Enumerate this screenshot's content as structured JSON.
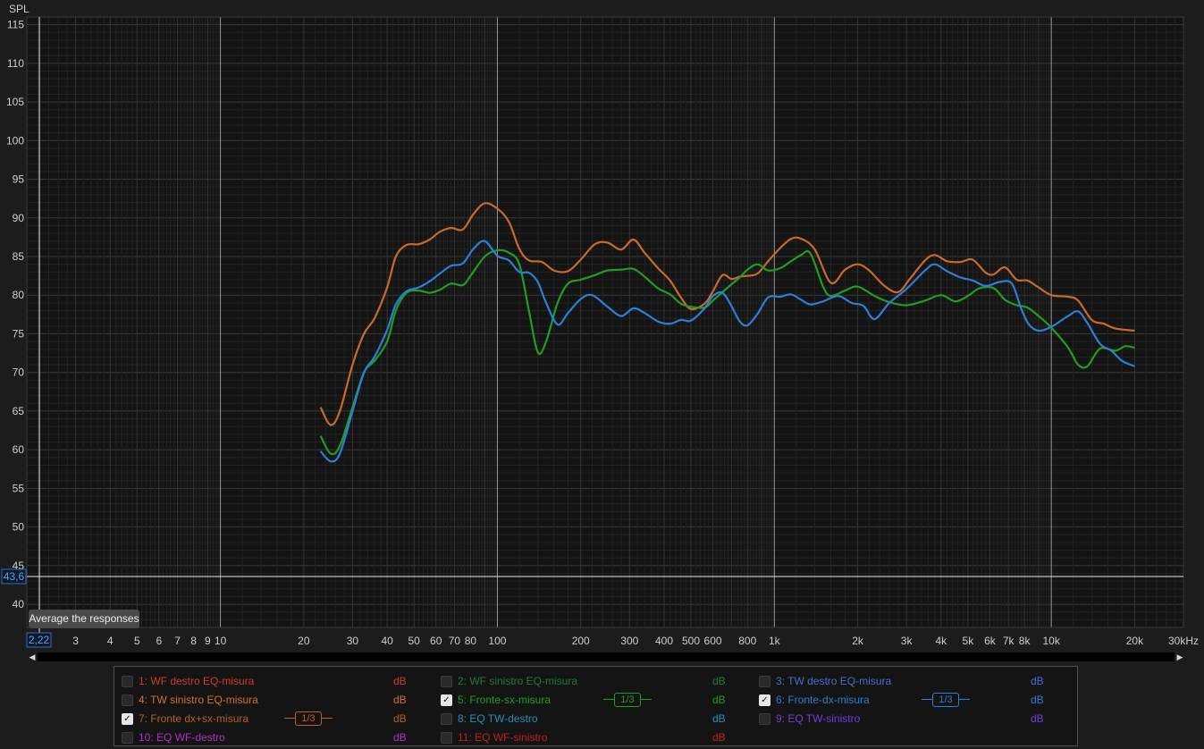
{
  "chart_data": {
    "type": "line",
    "ylabel": "SPL",
    "xunit": "kHz",
    "xscale": "log",
    "xlim": [
      2,
      30000
    ],
    "ylim": [
      37,
      116
    ],
    "grid": true,
    "y_ticks": [
      115,
      110,
      105,
      100,
      95,
      90,
      85,
      80,
      75,
      70,
      65,
      60,
      55,
      50,
      45,
      40
    ],
    "x_ticks": [
      {
        "v": 3,
        "label": "3"
      },
      {
        "v": 4,
        "label": "4"
      },
      {
        "v": 5,
        "label": "5"
      },
      {
        "v": 6,
        "label": "6"
      },
      {
        "v": 7,
        "label": "7"
      },
      {
        "v": 8,
        "label": "8"
      },
      {
        "v": 9,
        "label": "9"
      },
      {
        "v": 10,
        "label": "10"
      },
      {
        "v": 20,
        "label": "20"
      },
      {
        "v": 30,
        "label": "30"
      },
      {
        "v": 40,
        "label": "40"
      },
      {
        "v": 50,
        "label": "50"
      },
      {
        "v": 60,
        "label": "60"
      },
      {
        "v": 70,
        "label": "70"
      },
      {
        "v": 80,
        "label": "80"
      },
      {
        "v": 100,
        "label": "100"
      },
      {
        "v": 200,
        "label": "200"
      },
      {
        "v": 300,
        "label": "300"
      },
      {
        "v": 400,
        "label": "400"
      },
      {
        "v": 500,
        "label": "500"
      },
      {
        "v": 600,
        "label": "600"
      },
      {
        "v": 800,
        "label": "800"
      },
      {
        "v": 1000,
        "label": "1k"
      },
      {
        "v": 2000,
        "label": "2k"
      },
      {
        "v": 3000,
        "label": "3k"
      },
      {
        "v": 4000,
        "label": "4k"
      },
      {
        "v": 5000,
        "label": "5k"
      },
      {
        "v": 6000,
        "label": "6k"
      },
      {
        "v": 7000,
        "label": "7k"
      },
      {
        "v": 8000,
        "label": "8k"
      },
      {
        "v": 10000,
        "label": "10k"
      },
      {
        "v": 20000,
        "label": "20k"
      },
      {
        "v": 30000,
        "label": "30kHz"
      }
    ],
    "cursor": {
      "x_label": "2,22",
      "y_label": "43,6",
      "x_value": 2.22,
      "y_value": 43.6
    },
    "series": [
      {
        "name": "7: Fronte dx+sx-misura",
        "color": "#c96a28",
        "points": [
          [
            23,
            65.5
          ],
          [
            25,
            63.2
          ],
          [
            27,
            65
          ],
          [
            30,
            71
          ],
          [
            33,
            75
          ],
          [
            36,
            77
          ],
          [
            40,
            81
          ],
          [
            43,
            85
          ],
          [
            47,
            86.5
          ],
          [
            52,
            86.6
          ],
          [
            57,
            87.2
          ],
          [
            62,
            88.2
          ],
          [
            68,
            88.7
          ],
          [
            75,
            88.5
          ],
          [
            82,
            90.5
          ],
          [
            90,
            91.9
          ],
          [
            100,
            91.2
          ],
          [
            110,
            89.5
          ],
          [
            120,
            86
          ],
          [
            130,
            84.5
          ],
          [
            145,
            84.3
          ],
          [
            160,
            83.2
          ],
          [
            180,
            83.1
          ],
          [
            200,
            84.6
          ],
          [
            225,
            86.6
          ],
          [
            250,
            86.8
          ],
          [
            280,
            85.9
          ],
          [
            310,
            87.2
          ],
          [
            340,
            85.5
          ],
          [
            380,
            83.5
          ],
          [
            420,
            81.9
          ],
          [
            460,
            79.7
          ],
          [
            500,
            78.2
          ],
          [
            560,
            78.9
          ],
          [
            600,
            80.5
          ],
          [
            650,
            82.6
          ],
          [
            700,
            82.1
          ],
          [
            750,
            82.4
          ],
          [
            800,
            82.5
          ],
          [
            870,
            82.8
          ],
          [
            950,
            84.4
          ],
          [
            1050,
            86.1
          ],
          [
            1150,
            87.3
          ],
          [
            1250,
            87.3
          ],
          [
            1400,
            85.9
          ],
          [
            1600,
            81.6
          ],
          [
            1800,
            83.3
          ],
          [
            2000,
            84
          ],
          [
            2200,
            83.2
          ],
          [
            2500,
            81.2
          ],
          [
            2800,
            80.4
          ],
          [
            3100,
            82.2
          ],
          [
            3500,
            84.5
          ],
          [
            3800,
            85.2
          ],
          [
            4200,
            84.4
          ],
          [
            4700,
            84.3
          ],
          [
            5200,
            84.6
          ],
          [
            5800,
            82.9
          ],
          [
            6200,
            82.7
          ],
          [
            6800,
            83.6
          ],
          [
            7500,
            82
          ],
          [
            8200,
            81.9
          ],
          [
            9000,
            81
          ],
          [
            10000,
            80
          ],
          [
            11500,
            79.8
          ],
          [
            12500,
            79.3
          ],
          [
            14000,
            76.8
          ],
          [
            15500,
            76.3
          ],
          [
            17000,
            75.7
          ],
          [
            20000,
            75.4
          ]
        ]
      },
      {
        "name": "5: Fronte-sx-misura",
        "color": "#1f9e1f",
        "points": [
          [
            23,
            61.8
          ],
          [
            25,
            59.5
          ],
          [
            27,
            60.5
          ],
          [
            30,
            65.5
          ],
          [
            33,
            70
          ],
          [
            36,
            71.5
          ],
          [
            40,
            74
          ],
          [
            43,
            78
          ],
          [
            47,
            80.3
          ],
          [
            52,
            80.6
          ],
          [
            57,
            80.3
          ],
          [
            62,
            80.7
          ],
          [
            68,
            81.5
          ],
          [
            75,
            81.3
          ],
          [
            80,
            82.5
          ],
          [
            90,
            85
          ],
          [
            100,
            85.8
          ],
          [
            110,
            85.5
          ],
          [
            120,
            84
          ],
          [
            130,
            78
          ],
          [
            140,
            72.6
          ],
          [
            150,
            74
          ],
          [
            165,
            79
          ],
          [
            180,
            81.5
          ],
          [
            200,
            82
          ],
          [
            225,
            82.6
          ],
          [
            250,
            83.2
          ],
          [
            280,
            83.3
          ],
          [
            310,
            83.4
          ],
          [
            340,
            82.4
          ],
          [
            380,
            80.9
          ],
          [
            420,
            80.1
          ],
          [
            460,
            78.9
          ],
          [
            500,
            78.5
          ],
          [
            560,
            78.4
          ],
          [
            600,
            79.3
          ],
          [
            650,
            80.4
          ],
          [
            700,
            81.4
          ],
          [
            750,
            82.3
          ],
          [
            800,
            83.3
          ],
          [
            870,
            84
          ],
          [
            950,
            83.2
          ],
          [
            1050,
            83.5
          ],
          [
            1150,
            84.4
          ],
          [
            1250,
            85.2
          ],
          [
            1350,
            85.4
          ],
          [
            1500,
            81.1
          ],
          [
            1600,
            79.9
          ],
          [
            1800,
            80.6
          ],
          [
            2000,
            81.1
          ],
          [
            2300,
            79.9
          ],
          [
            2600,
            79.1
          ],
          [
            3000,
            78.7
          ],
          [
            3500,
            79.3
          ],
          [
            4000,
            80
          ],
          [
            4500,
            79.2
          ],
          [
            5000,
            79.9
          ],
          [
            5500,
            80.9
          ],
          [
            6200,
            80.9
          ],
          [
            6800,
            79.4
          ],
          [
            7500,
            78.7
          ],
          [
            8200,
            78.4
          ],
          [
            9000,
            77.3
          ],
          [
            10000,
            75.8
          ],
          [
            11500,
            73.2
          ],
          [
            12500,
            71
          ],
          [
            13500,
            70.8
          ],
          [
            15000,
            73.1
          ],
          [
            17000,
            72.8
          ],
          [
            18500,
            73.4
          ],
          [
            20000,
            73.2
          ]
        ]
      },
      {
        "name": "6: Fronte-dx-misura",
        "color": "#2c7fd6",
        "points": [
          [
            23,
            59.8
          ],
          [
            25,
            58.5
          ],
          [
            27,
            59.5
          ],
          [
            30,
            65
          ],
          [
            33,
            70
          ],
          [
            36,
            72
          ],
          [
            40,
            75.5
          ],
          [
            43,
            78.8
          ],
          [
            47,
            80.5
          ],
          [
            52,
            81
          ],
          [
            57,
            81.8
          ],
          [
            62,
            82.8
          ],
          [
            68,
            83.8
          ],
          [
            75,
            84.1
          ],
          [
            82,
            86
          ],
          [
            90,
            87
          ],
          [
            100,
            85.1
          ],
          [
            110,
            84.5
          ],
          [
            120,
            83
          ],
          [
            130,
            82.9
          ],
          [
            140,
            81.7
          ],
          [
            150,
            79
          ],
          [
            165,
            76.2
          ],
          [
            180,
            77.7
          ],
          [
            200,
            79.5
          ],
          [
            220,
            80
          ],
          [
            250,
            78.5
          ],
          [
            280,
            77.3
          ],
          [
            310,
            78.3
          ],
          [
            340,
            77.7
          ],
          [
            380,
            76.6
          ],
          [
            420,
            76.3
          ],
          [
            460,
            76.8
          ],
          [
            500,
            76.7
          ],
          [
            560,
            78.3
          ],
          [
            600,
            79.9
          ],
          [
            650,
            80.3
          ],
          [
            700,
            78.6
          ],
          [
            750,
            76.6
          ],
          [
            800,
            76.1
          ],
          [
            870,
            77.6
          ],
          [
            950,
            79.7
          ],
          [
            1050,
            79.8
          ],
          [
            1150,
            80.1
          ],
          [
            1250,
            79.4
          ],
          [
            1350,
            78.8
          ],
          [
            1500,
            79.2
          ],
          [
            1700,
            79.9
          ],
          [
            1900,
            79
          ],
          [
            2100,
            78.6
          ],
          [
            2300,
            76.9
          ],
          [
            2600,
            79
          ],
          [
            3000,
            80.8
          ],
          [
            3500,
            83.2
          ],
          [
            3800,
            84
          ],
          [
            4200,
            83.1
          ],
          [
            4700,
            82.3
          ],
          [
            5200,
            81.9
          ],
          [
            5800,
            81.2
          ],
          [
            6500,
            81.7
          ],
          [
            7200,
            81.5
          ],
          [
            7800,
            78.2
          ],
          [
            8300,
            76.2
          ],
          [
            9000,
            75.4
          ],
          [
            10000,
            75.9
          ],
          [
            11500,
            77.3
          ],
          [
            12500,
            77.9
          ],
          [
            13500,
            76.4
          ],
          [
            15000,
            73.7
          ],
          [
            16500,
            72.8
          ],
          [
            18000,
            71.5
          ],
          [
            20000,
            70.8
          ]
        ]
      }
    ]
  },
  "tooltip": "Average the responses",
  "legend": [
    {
      "label": "1: WF destro EQ-misura",
      "unit": "dB",
      "checked": false,
      "color": "#d23a2a",
      "col": 0,
      "row": 0
    },
    {
      "label": "2: WF sinistro EQ-misura",
      "unit": "dB",
      "checked": false,
      "color": "#1f7a3a",
      "col": 1,
      "row": 0
    },
    {
      "label": "3: TW destro EQ-misura",
      "unit": "dB",
      "checked": false,
      "color": "#4a6cd0",
      "col": 2,
      "row": 0
    },
    {
      "label": "4: TW sinistro EQ-misura",
      "unit": "dB",
      "checked": false,
      "color": "#d4702c",
      "col": 0,
      "row": 1
    },
    {
      "label": "5: Fronte-sx-misura",
      "unit": "dB",
      "checked": true,
      "color": "#1f9e1f",
      "smoothing": "1/3",
      "col": 1,
      "row": 1
    },
    {
      "label": "6: Fronte-dx-misura",
      "unit": "dB",
      "checked": true,
      "color": "#2c7fd6",
      "smoothing": "1/3",
      "col": 2,
      "row": 1
    },
    {
      "label": "7: Fronte dx+sx-misura",
      "unit": "dB",
      "checked": true,
      "color": "#b85f22",
      "smoothing": "1/3",
      "col": 0,
      "row": 2
    },
    {
      "label": "8: EQ TW-destro",
      "unit": "dB",
      "checked": false,
      "color": "#2a8fb0",
      "col": 1,
      "row": 2
    },
    {
      "label": "9: EQ TW-sinistro",
      "unit": "dB",
      "checked": false,
      "color": "#7040d8",
      "col": 2,
      "row": 2
    },
    {
      "label": "10: EQ WF-destro",
      "unit": "dB",
      "checked": false,
      "color": "#b030c8",
      "col": 0,
      "row": 3
    },
    {
      "label": "11: EQ WF-sinistro",
      "unit": "dB",
      "checked": false,
      "color": "#c02020",
      "col": 1,
      "row": 3
    }
  ]
}
